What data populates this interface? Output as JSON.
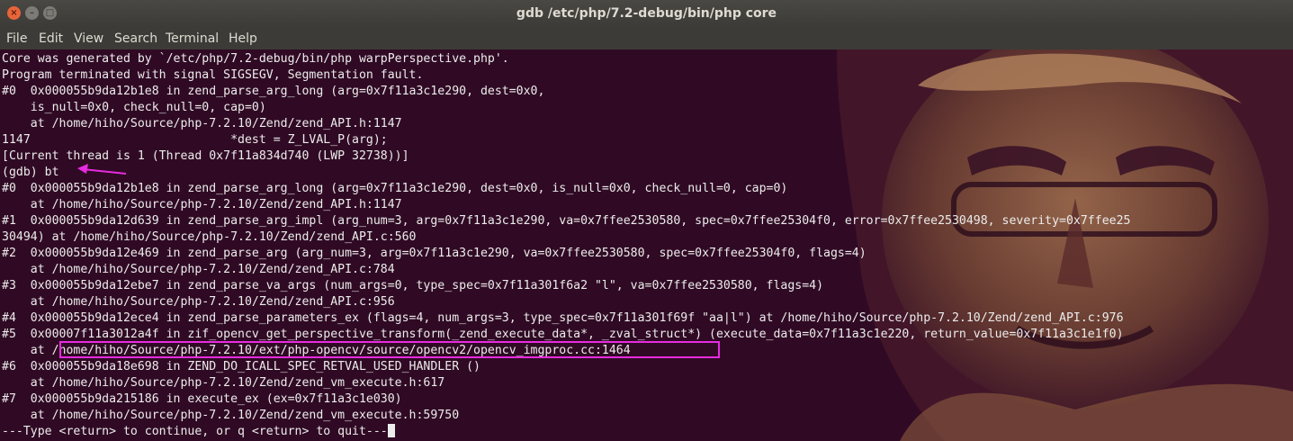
{
  "window": {
    "title": "gdb /etc/php/7.2-debug/bin/php core",
    "close_glyph": "×",
    "minimize_glyph": "–",
    "maximize_glyph": "□"
  },
  "menu": [
    "File",
    "Edit",
    "View",
    "Search",
    "Terminal",
    "Help"
  ],
  "terminal": {
    "lines": [
      "Core was generated by `/etc/php/7.2-debug/bin/php warpPerspective.php'.",
      "Program terminated with signal SIGSEGV, Segmentation fault.",
      "#0  0x000055b9da12b1e8 in zend_parse_arg_long (arg=0x7f11a3c1e290, dest=0x0,",
      "    is_null=0x0, check_null=0, cap=0)",
      "    at /home/hiho/Source/php-7.2.10/Zend/zend_API.h:1147",
      "1147\t\t\t\t*dest = Z_LVAL_P(arg);",
      "[Current thread is 1 (Thread 0x7f11a834d740 (LWP 32738))]",
      "(gdb) bt",
      "#0  0x000055b9da12b1e8 in zend_parse_arg_long (arg=0x7f11a3c1e290, dest=0x0, is_null=0x0, check_null=0, cap=0)",
      "    at /home/hiho/Source/php-7.2.10/Zend/zend_API.h:1147",
      "#1  0x000055b9da12d639 in zend_parse_arg_impl (arg_num=3, arg=0x7f11a3c1e290, va=0x7ffee2530580, spec=0x7ffee25304f0, error=0x7ffee2530498, severity=0x7ffee25",
      "30494) at /home/hiho/Source/php-7.2.10/Zend/zend_API.c:560",
      "#2  0x000055b9da12e469 in zend_parse_arg (arg_num=3, arg=0x7f11a3c1e290, va=0x7ffee2530580, spec=0x7ffee25304f0, flags=4)",
      "    at /home/hiho/Source/php-7.2.10/Zend/zend_API.c:784",
      "#3  0x000055b9da12ebe7 in zend_parse_va_args (num_args=0, type_spec=0x7f11a301f6a2 \"l\", va=0x7ffee2530580, flags=4)",
      "    at /home/hiho/Source/php-7.2.10/Zend/zend_API.c:956",
      "#4  0x000055b9da12ece4 in zend_parse_parameters_ex (flags=4, num_args=3, type_spec=0x7f11a301f69f \"aa|l\") at /home/hiho/Source/php-7.2.10/Zend/zend_API.c:976",
      "#5  0x00007f11a3012a4f in zif_opencv_get_perspective_transform(_zend_execute_data*, _zval_struct*) (execute_data=0x7f11a3c1e220, return_value=0x7f11a3c1e1f0)",
      "    at /home/hiho/Source/php-7.2.10/ext/php-opencv/source/opencv2/opencv_imgproc.cc:1464",
      "#6  0x000055b9da18e698 in ZEND_DO_ICALL_SPEC_RETVAL_USED_HANDLER ()",
      "    at /home/hiho/Source/php-7.2.10/Zend/zend_vm_execute.h:617",
      "#7  0x000055b9da215186 in execute_ex (ex=0x7f11a3c1e030)",
      "    at /home/hiho/Source/php-7.2.10/Zend/zend_vm_execute.h:59750",
      "---Type <return> to continue, or q <return> to quit---"
    ]
  },
  "colors": {
    "terminal_bg": "#300a24",
    "text": "#ececec",
    "annotation": "#e62be0"
  }
}
